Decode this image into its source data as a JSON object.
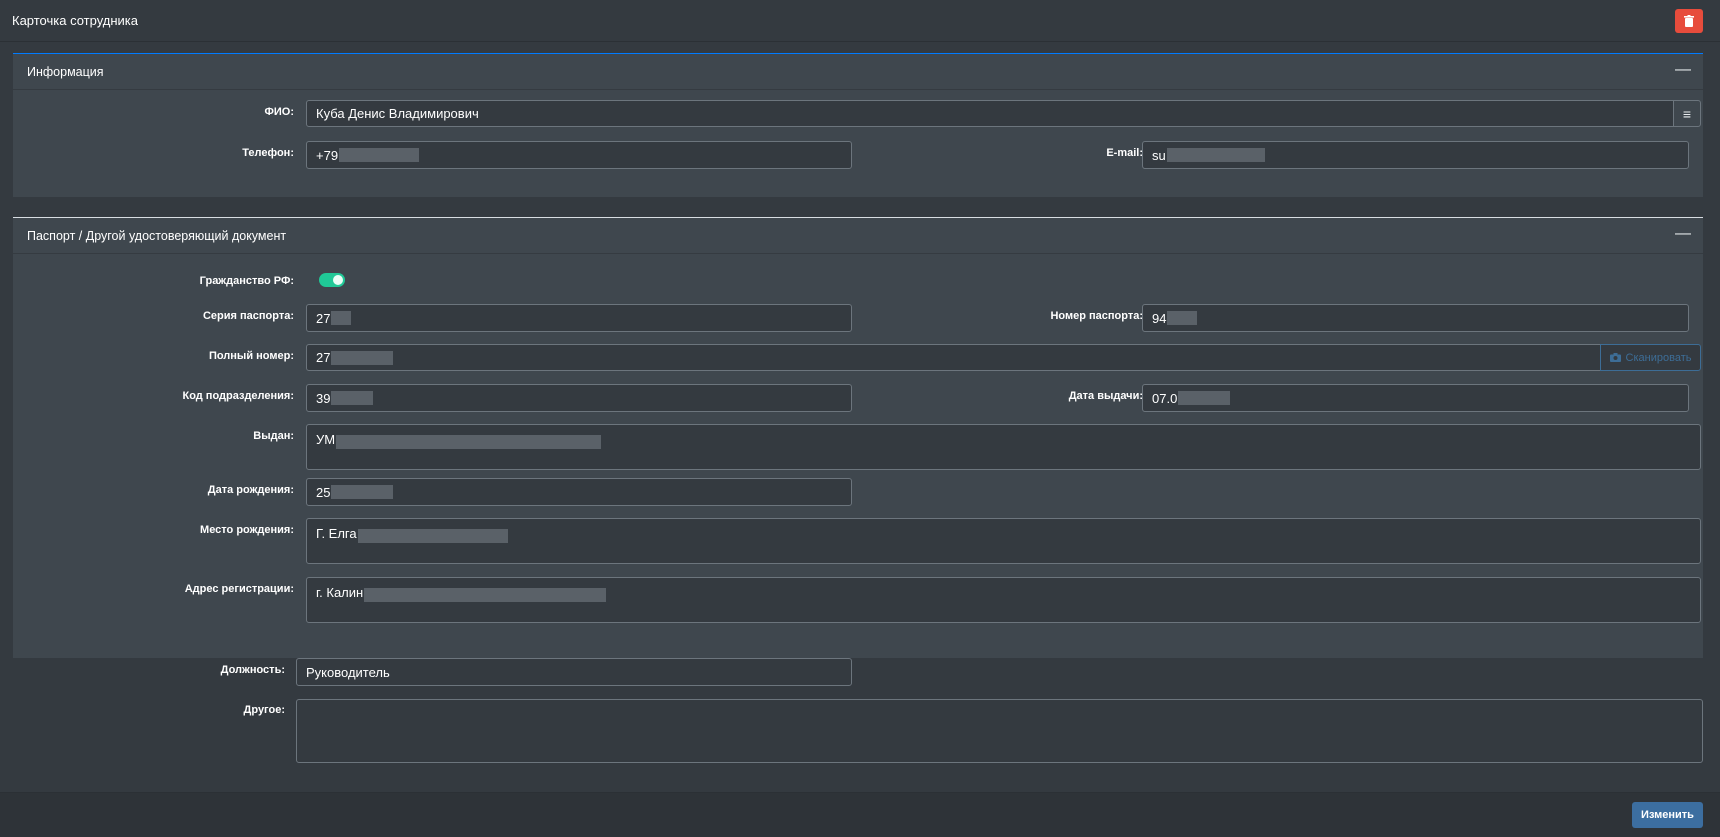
{
  "header": {
    "title": "Карточка сотрудника"
  },
  "sections": {
    "info": {
      "title": "Информация",
      "fio_label": "ФИО:",
      "fio_value": "Куба Денис Владимирович",
      "phone_label": "Телефон:",
      "phone_value": "+79",
      "email_label": "E-mail:",
      "email_value": "su"
    },
    "passport": {
      "title": "Паспорт / Другой удостоверяющий документ",
      "citizenship_label": "Гражданство РФ:",
      "series_label": "Серия паспорта:",
      "series_value": "27",
      "number_label": "Номер паспорта:",
      "number_value": "94",
      "full_number_label": "Полный номер:",
      "full_number_value": "27",
      "scan_label": "Сканировать",
      "dept_code_label": "Код подразделения:",
      "dept_code_value": "39",
      "issue_date_label": "Дата выдачи:",
      "issue_date_value": "07.0",
      "issued_by_label": "Выдан:",
      "issued_by_value": "УМ",
      "birth_date_label": "Дата рождения:",
      "birth_date_value": "25",
      "birth_place_label": "Место рождения:",
      "birth_place_value": "Г. Елга",
      "reg_address_label": "Адрес регистрации:",
      "reg_address_value": "г. Калин"
    }
  },
  "position": {
    "label": "Должность:",
    "value": "Руководитель"
  },
  "other": {
    "label": "Другое:",
    "value": ""
  },
  "footer": {
    "save_label": "Изменить"
  },
  "colors": {
    "accent": "#007bff",
    "danger": "#e74c3c",
    "toggle_on": "#20c997",
    "primary_button": "#3c6ea0"
  }
}
